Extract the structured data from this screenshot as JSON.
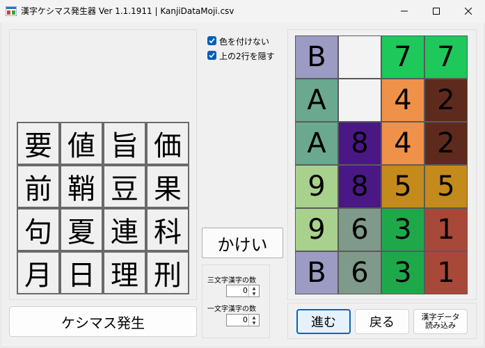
{
  "window": {
    "title": "漢字ケシマス発生器 Ver 1.1.1911 | KanjiDataMoji.csv",
    "minimize_glyph": "─",
    "maximize_glyph": "☐",
    "close_glyph": "✕"
  },
  "kanji_grid": [
    [
      "要",
      "値",
      "旨",
      "価"
    ],
    [
      "前",
      "鞘",
      "豆",
      "果"
    ],
    [
      "句",
      "夏",
      "連",
      "科"
    ],
    [
      "月",
      "日",
      "理",
      "刑"
    ]
  ],
  "options": {
    "no_color_label": "色を付けない",
    "no_color_checked": true,
    "hide_top_two_label": "上の2行を隠す",
    "hide_top_two_checked": true
  },
  "kakei_button_label": "かけい",
  "counts": {
    "three_char_label": "三文字漢字の数",
    "three_char_value": "0",
    "one_char_label": "一文字漢字の数",
    "one_char_value": "0"
  },
  "generate_button_label": "ケシマス発生",
  "color_grid": [
    [
      {
        "t": "B",
        "c": "#9b9bc4"
      },
      {
        "t": "",
        "c": "#f3f3f3"
      },
      {
        "t": "7",
        "c": "#1ec85a"
      },
      {
        "t": "7",
        "c": "#1ec85a"
      }
    ],
    [
      {
        "t": "A",
        "c": "#6aa98f"
      },
      {
        "t": "",
        "c": "#f3f3f3"
      },
      {
        "t": "4",
        "c": "#f0914a"
      },
      {
        "t": "2",
        "c": "#5e2a1e"
      }
    ],
    [
      {
        "t": "A",
        "c": "#6aa98f"
      },
      {
        "t": "8",
        "c": "#4a1884"
      },
      {
        "t": "4",
        "c": "#f0914a"
      },
      {
        "t": "2",
        "c": "#5e2a1e"
      }
    ],
    [
      {
        "t": "9",
        "c": "#a9d18e"
      },
      {
        "t": "8",
        "c": "#4a1884"
      },
      {
        "t": "5",
        "c": "#c48a1c"
      },
      {
        "t": "5",
        "c": "#c48a1c"
      }
    ],
    [
      {
        "t": "9",
        "c": "#a9d18e"
      },
      {
        "t": "6",
        "c": "#7f9a8b"
      },
      {
        "t": "3",
        "c": "#1fa84a"
      },
      {
        "t": "1",
        "c": "#a84838"
      }
    ],
    [
      {
        "t": "B",
        "c": "#9b9bc4"
      },
      {
        "t": "6",
        "c": "#7f9a8b"
      },
      {
        "t": "3",
        "c": "#1fa84a"
      },
      {
        "t": "1",
        "c": "#a84838"
      }
    ]
  ],
  "nav": {
    "next_label": "進む",
    "back_label": "戻る",
    "load_label_line1": "漢字データ",
    "load_label_line2": "読み込み"
  }
}
